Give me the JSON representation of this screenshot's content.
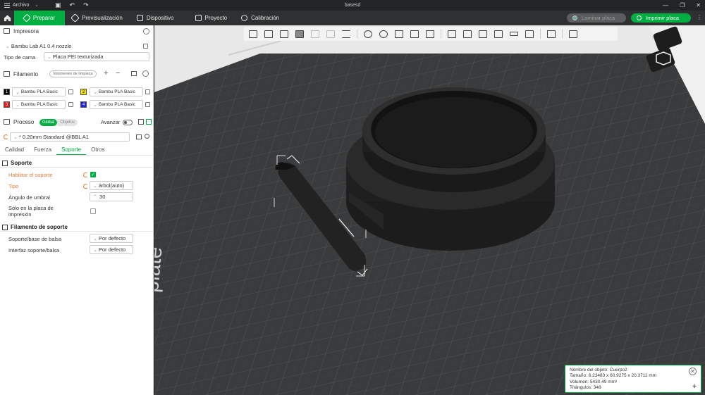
{
  "titlebar": {
    "menu_label": "Archivo",
    "title": "basesd"
  },
  "nav": {
    "tabs": [
      {
        "label": "Preparar"
      },
      {
        "label": "Previsualización"
      },
      {
        "label": "Dispositivo"
      },
      {
        "label": "Proyecto"
      },
      {
        "label": "Calibración"
      }
    ],
    "slice_label": "Laminar placa",
    "print_label": "Imprimir placa"
  },
  "printer": {
    "section_label": "Impresora",
    "name": "Bambu Lab A1 0.4 nozzle",
    "bed_label": "Tipo de cama",
    "bed_value": "Placa PEI texturizada"
  },
  "filament": {
    "section_label": "Filamento",
    "flush_label": "Volúmenes de limpieza",
    "slots": [
      {
        "num": "1",
        "color": "#000000",
        "name": "Bambu PLA Basic"
      },
      {
        "num": "2",
        "color": "#f5e50b",
        "name": "Bambu PLA Basic"
      },
      {
        "num": "3",
        "color": "#e8161b",
        "name": "Bambu PLA Basic"
      },
      {
        "num": "4",
        "color": "#1e22e0",
        "name": "Bambu PLA Basic"
      }
    ]
  },
  "process": {
    "section_label": "Proceso",
    "seg_global": "Global",
    "seg_objects": "Objetos",
    "advanced_label": "Avanzar",
    "preset": "* 0.20mm Standard @BBL A1",
    "tabs": [
      "Calidad",
      "Fuerza",
      "Soporte",
      "Otros"
    ],
    "support_group": "Soporte",
    "enable_support": "Habilitar el soporte",
    "type_label": "Tipo",
    "type_value": "árbol(auto)",
    "threshold_label": "Ángulo de umbral",
    "threshold_value": "30",
    "only_plate_label": "Sólo en la placa de impresión",
    "filament_group": "Filamento de soporte",
    "base_label": "Soporte/base de balsa",
    "base_value": "Por defecto",
    "interface_label": "Interfaz soporte/balsa",
    "interface_value": "Por defecto"
  },
  "viewport": {
    "plate_text": "plate"
  },
  "object_info": {
    "name": "Nombre del objeto: Cuerpo2",
    "size": "Tamaño: 6.23483 x 60.9275 x 20.3711 mm",
    "volume": "Volumen: 5430.49 mm³",
    "triangles": "Triángulos: 348"
  },
  "colors": {
    "accent": "#00ae42",
    "modified": "#e07a3d"
  }
}
